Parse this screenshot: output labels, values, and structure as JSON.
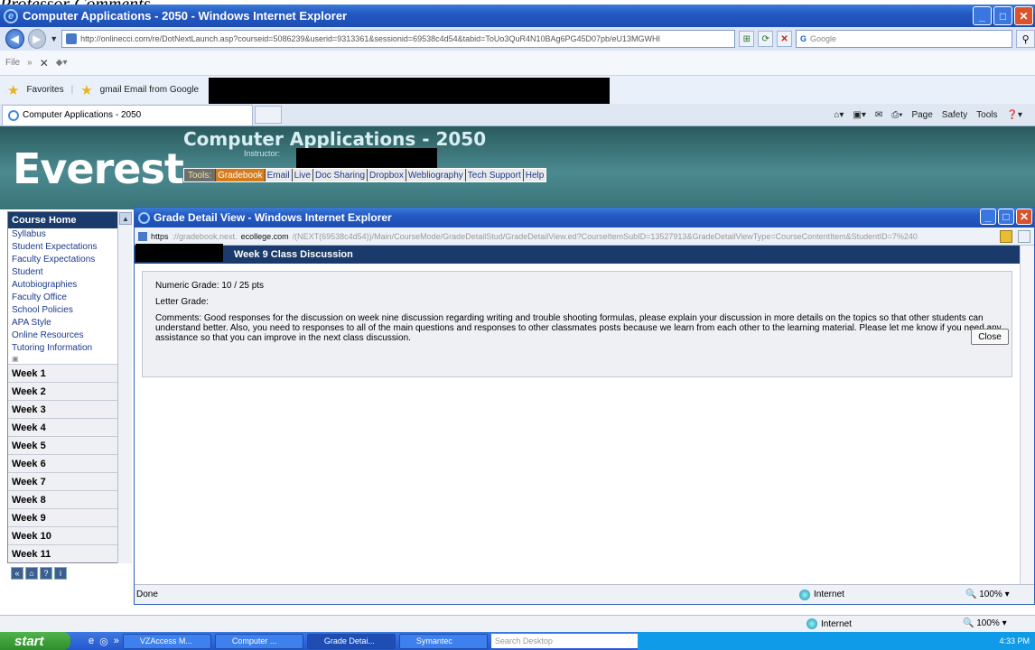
{
  "doc_caption": "Professor Comments",
  "browser": {
    "title": "Computer Applications - 2050 - Windows Internet Explorer",
    "url": "http://onlinecci.com/re/DotNextLaunch.asp?courseid=5086239&userid=9313361&sessionid=69538c4d54&tabid=ToUo3QuR4N10BAg6PG45D07pb/eU13MGWHI",
    "search_label": "Google",
    "menu_label": "File",
    "favorites_label": "Favorites",
    "favorite_item": "gmail Email from Google",
    "tab_label": "Computer Applications - 2050",
    "tab_tools": [
      "Page",
      "Safety",
      "Tools"
    ],
    "status_text": "Internet",
    "zoom": "100%"
  },
  "course": {
    "logo": "Everest",
    "title": "Computer Applications - 2050",
    "instructor_label": "Instructor:",
    "tools_label": "Tools:",
    "tools": [
      "Gradebook",
      "Email",
      "Live",
      "Doc Sharing",
      "Dropbox",
      "Webliography",
      "Tech Support",
      "Help"
    ]
  },
  "sidebar": {
    "head": "Course Home",
    "links": [
      "Syllabus",
      "Student Expectations",
      "Faculty Expectations",
      "Student Autobiographies",
      "Faculty Office",
      "School Policies",
      "APA Style",
      "Online Resources",
      "Tutoring Information"
    ],
    "weeks": [
      "Week 1",
      "Week 2",
      "Week 3",
      "Week 4",
      "Week 5",
      "Week 6",
      "Week 7",
      "Week 8",
      "Week 9",
      "Week 10",
      "Week 11"
    ]
  },
  "popup": {
    "title": "Grade Detail View - Windows Internet Explorer",
    "url_prefix": "https",
    "url_host_pre": "://gradebook.next.",
    "url_host_bold": "ecollege.com",
    "url_rest": "/(NEXT(69538c4d54))/Main/CourseMode/GradeDetailStud/GradeDetailView.ed?CourseItemSubID=13527913&GradeDetailViewType=CourseContentItem&StudentID=7%240",
    "band_title": "Week 9 Class Discussion",
    "numeric_grade": "Numeric Grade:  10 / 25  pts",
    "letter_grade": "Letter Grade:",
    "comments": "Comments: Good responses for the discussion on week nine discussion regarding writing and trouble shooting formulas, please explain your discussion in more details on the topics so that other students can understand better. Also, you need to responses to all of the main questions and responses to other classmates posts because we learn from each other to the learning material. Please let me know if you need any assistance so that you can improve in the next class discussion.",
    "close_label": "Close",
    "status_done": "Done",
    "status_zone": "Internet",
    "zoom": "100%"
  },
  "taskbar": {
    "start": "start",
    "items": [
      "VZAccess M...",
      "Computer ...",
      "Grade Detai...",
      "Symantec"
    ],
    "search_placeholder": "Search Desktop",
    "clock": "4:33 PM"
  }
}
